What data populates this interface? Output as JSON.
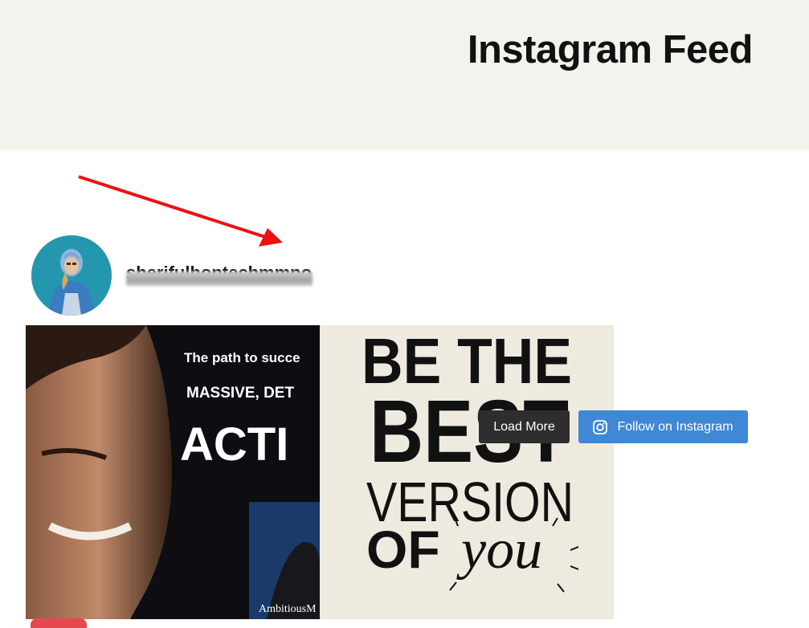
{
  "header": {
    "title": "Instagram Feed"
  },
  "profile": {
    "username": "sherifulhontechmmno",
    "avatar_icon": "person-avatar"
  },
  "feed": {
    "posts": [
      {
        "lines": [
          "The path to succe",
          "MASSIVE, DET",
          "ACTI",
          "AmbitiousM"
        ]
      },
      {
        "lines": [
          "BE THE",
          "BEST",
          "VERSION",
          "OF",
          "you"
        ]
      }
    ]
  },
  "actions": {
    "load_more_label": "Load More",
    "follow_label": "Follow on Instagram",
    "follow_icon": "instagram-icon"
  },
  "colors": {
    "header_bg": "#f3f2ec",
    "load_more_bg": "#2e2e2e",
    "follow_bg": "#3f88d6",
    "annotation_arrow": "#ee1111"
  }
}
